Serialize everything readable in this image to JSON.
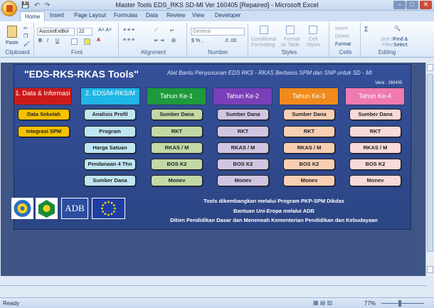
{
  "window": {
    "title": "Master Tools EDS_RKS SD-MI Ver 160405 [Repaired] - Microsoft Excel"
  },
  "qat": {
    "save": "💾",
    "undo": "↶",
    "redo": "↷"
  },
  "tabs": [
    "Home",
    "Insert",
    "Page Layout",
    "Formulas",
    "Data",
    "Review",
    "View",
    "Developer"
  ],
  "ribbon": {
    "paste_label": "Paste",
    "font_name": "AucoinExtBol",
    "font_size": "22",
    "number_format": "General",
    "groups": {
      "clipboard": "Clipboard",
      "font": "Font",
      "alignment": "Alignment",
      "number": "Number",
      "styles": "Styles",
      "cells": "Cells",
      "editing": "Editing"
    },
    "styles": {
      "cond": "Conditional",
      "cond2": "Formatting",
      "format_table": "Format",
      "format_table2": "as Table",
      "cell_styles": "Cell",
      "cell_styles2": "Styles"
    },
    "cells": {
      "insert": "Insert",
      "delete": "Delete",
      "format": "Format"
    },
    "editing": {
      "sigma": "Σ",
      "sort": "Sort &",
      "sort2": "Filter",
      "find": "Find &",
      "find2": "Select"
    }
  },
  "banner": {
    "title": "\"EDS-RKS-RKAS Tools\"",
    "subtitle": "Alat Bantu Penyusunan EDS RKS - RKAS Berbasis SPM dan SNP untuk SD - MI",
    "version": "Versi : 160405"
  },
  "columns": [
    {
      "header": "1. Data & Informasi",
      "color": "#cc1b1b",
      "btn": "#f7c200",
      "items": [
        "Data Sekolah",
        "Integrasi SPM"
      ]
    },
    {
      "header": "2. EDS/M-RKS/M",
      "color": "#1fb6e6",
      "btn": "#bfe6f2",
      "items": [
        "Analisis Profil",
        "Program",
        "Harga Satuan",
        "Pendanaan 4 Thn",
        "Sumber Dana"
      ]
    },
    {
      "header": "Tahun Ke-1",
      "color": "#1e9a3c",
      "btn": "#c2d9a6",
      "items": [
        "Sumber Dana",
        "RKT",
        "RKAS / M",
        "BOS K2",
        "Monev"
      ]
    },
    {
      "header": "Tahun Ke-2",
      "color": "#7a3fb8",
      "btn": "#d1c6e2",
      "items": [
        "Sumber Dana",
        "RKT",
        "RKAS / M",
        "BOS K2",
        "Monev"
      ]
    },
    {
      "header": "Tahun Ke-3",
      "color": "#f08a1c",
      "btn": "#f8cfb3",
      "items": [
        "Sumber Dana",
        "RKT",
        "RKAS / M",
        "BOS K2",
        "Monev"
      ]
    },
    {
      "header": "Tahun Ke-4",
      "color": "#f07ab2",
      "btn": "#f8dad8",
      "items": [
        "Sumber Dana",
        "RKT",
        "RKAS / M",
        "BOS K2",
        "Monev"
      ]
    }
  ],
  "logos": {
    "adb": "ADB"
  },
  "footer": [
    "Tools dikembangkan melalui Program PKP-SPM Dikdas",
    "Bantuan Uni-Eropa melalui ADB",
    "Ditien Pendidikan Dasar dan Meneneah  Kementerian Pendidikan dan Kebudayaan"
  ],
  "status": {
    "ready": "Ready",
    "zoom": "77%"
  }
}
